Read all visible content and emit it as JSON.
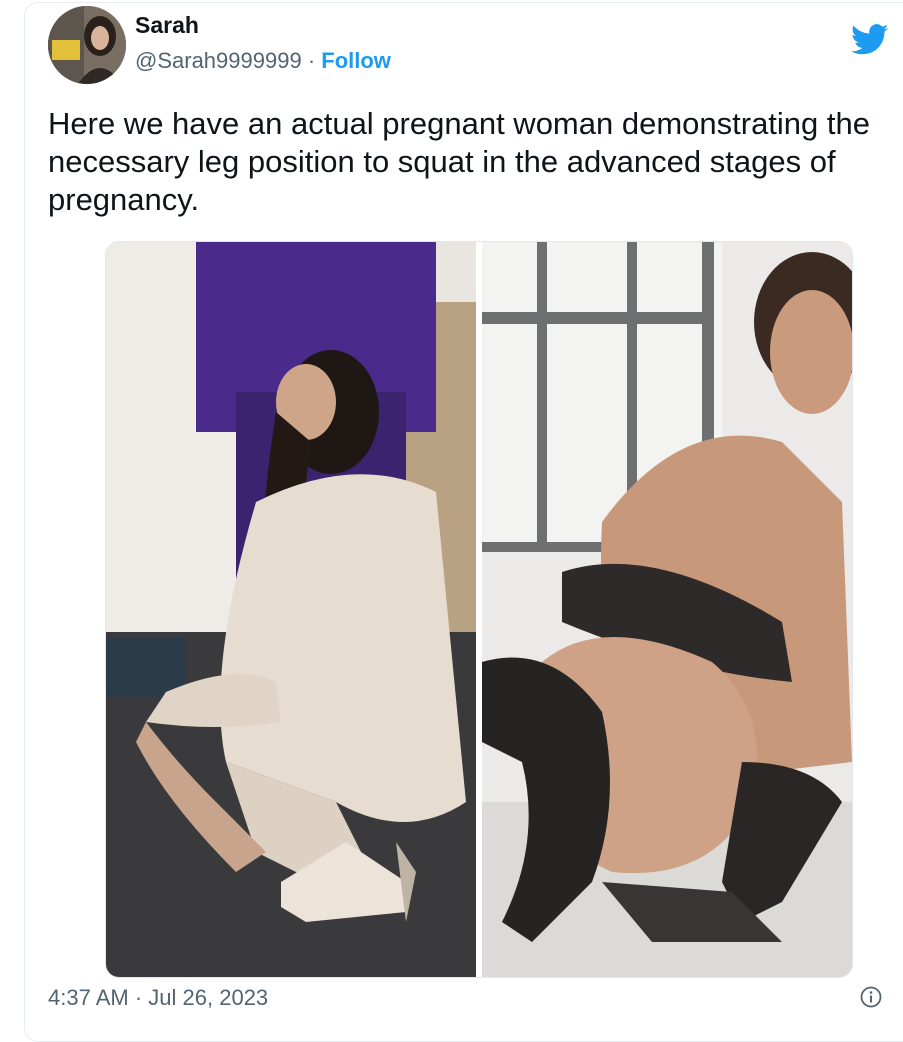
{
  "tweet": {
    "author": {
      "display_name": "Sarah",
      "handle": "@Sarah9999999",
      "separator": "·",
      "follow_label": "Follow"
    },
    "text": "Here we have an actual pregnant woman demonstrating the necessary leg position to squat in the advanced stages of pregnancy.",
    "media": [
      {
        "description_icon": "photo-woman-squatting-heels"
      },
      {
        "description_icon": "photo-pregnant-woman-squatting"
      }
    ],
    "time": "4:37 AM",
    "date_separator": "·",
    "date": "Jul 26, 2023"
  },
  "icons": {
    "brand": "twitter-bird-icon",
    "info": "info-icon"
  },
  "colors": {
    "accent": "#1d9bf0",
    "secondary_text": "#536471",
    "primary_text": "#0f1419",
    "border": "#e6ecf0"
  }
}
